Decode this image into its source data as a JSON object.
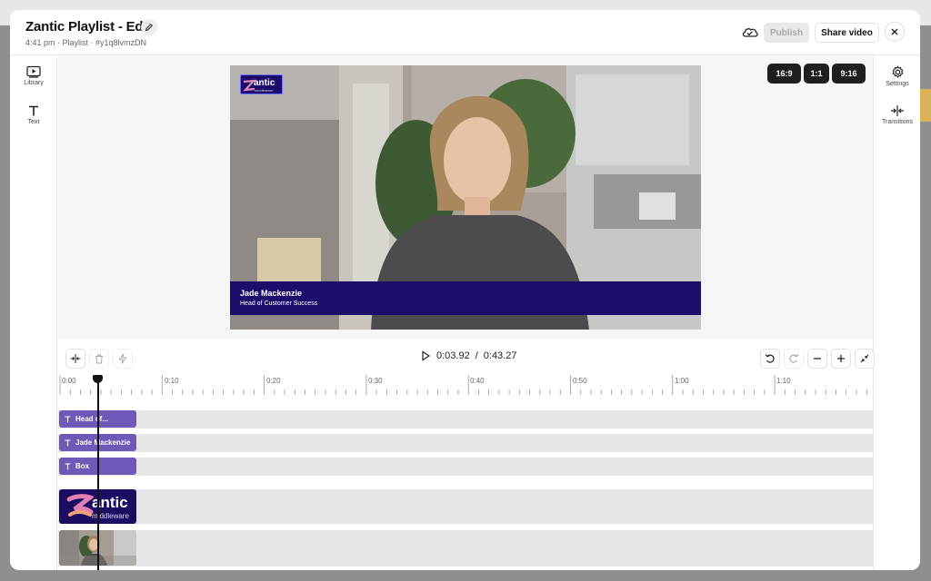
{
  "header": {
    "title": "Zantic Playlist - Edit",
    "subtitle": "4:41 pm · Playlist · #y1q8lvmzDN",
    "publish_label": "Publish",
    "share_label": "Share video"
  },
  "left_rail": [
    {
      "label": "Library",
      "icon": "library-icon"
    },
    {
      "label": "Text",
      "icon": "text-icon"
    }
  ],
  "right_rail": [
    {
      "label": "Settings",
      "icon": "gear-icon"
    },
    {
      "label": "Transitions",
      "icon": "transitions-icon"
    }
  ],
  "aspect_ratios": [
    "16:9",
    "1:1",
    "9:16"
  ],
  "video": {
    "logo_text": "antic",
    "logo_sub": "middleware",
    "lower_third_name": "Jade Mackenzie",
    "lower_third_role": "Head of Customer Success"
  },
  "playback": {
    "current_time": "0:03.92",
    "separator": "/",
    "total_time": "0:43.27"
  },
  "ruler_labels": [
    "0:00",
    "0:10",
    "0:20",
    "0:30",
    "0:40",
    "0:50",
    "1:00",
    "1:10"
  ],
  "tracks": [
    {
      "type": "text",
      "label": "Head of..."
    },
    {
      "type": "text",
      "label": "Jade Mackenzie"
    },
    {
      "type": "text",
      "label": "Box"
    },
    {
      "type": "image",
      "label": "antic",
      "sublabel": "middleware"
    },
    {
      "type": "video",
      "label": ""
    }
  ],
  "colors": {
    "accent_purple": "#6e58b8",
    "lower_third": "#1e0c6b",
    "dark_button": "#1f1f1f"
  }
}
